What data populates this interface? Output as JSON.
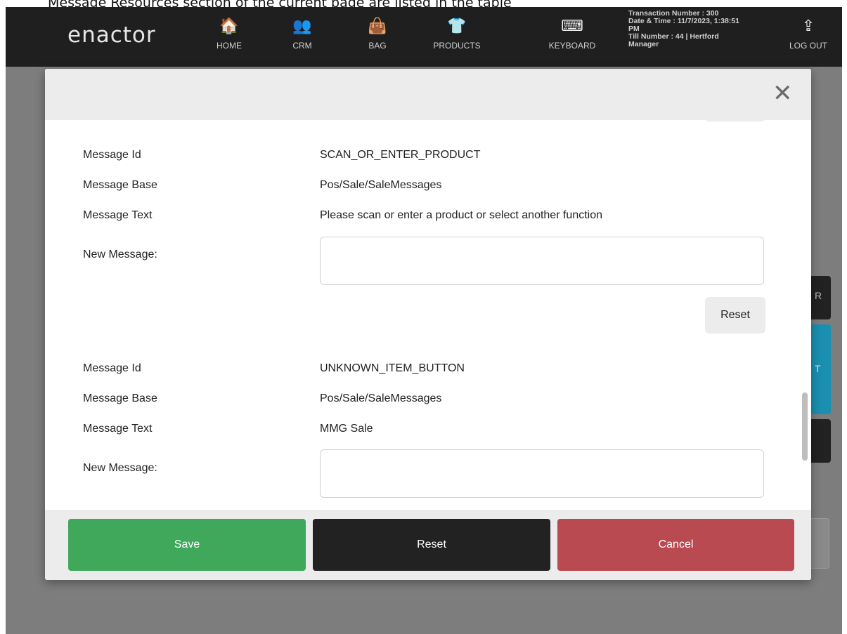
{
  "caption": "Message Resources section of the current page are listed in the table",
  "nav": {
    "logo": "enactor",
    "items": [
      {
        "label": "HOME",
        "icon": "home-icon",
        "glyph": "🏠"
      },
      {
        "label": "CRM",
        "icon": "people-icon",
        "glyph": "👥"
      },
      {
        "label": "BAG",
        "icon": "bag-icon",
        "glyph": "👜"
      },
      {
        "label": "PRODUCTS",
        "icon": "tshirt-icon",
        "glyph": "👕"
      },
      {
        "label": "KEYBOARD",
        "icon": "keyboard-icon",
        "glyph": "⌨"
      }
    ],
    "transaction_number": "Transaction Number : 300",
    "date_time": "Date & Time : 11/7/2023, 1:38:51 PM",
    "till": "Till Number : 44  |  Hertford Manager",
    "logout": {
      "label": "LOG OUT",
      "icon": "logout-icon",
      "glyph": "⇪"
    }
  },
  "modal": {
    "close_glyph": "✕",
    "messages": [
      {
        "id_label": "Message Id",
        "id_value": "SCAN_OR_ENTER_PRODUCT",
        "base_label": "Message Base",
        "base_value": "Pos/Sale/SaleMessages",
        "text_label": "Message Text",
        "text_value": "Please scan or enter a product or select another function",
        "new_label": "New Message:",
        "new_value": "",
        "reset_label": "Reset"
      },
      {
        "id_label": "Message Id",
        "id_value": "UNKNOWN_ITEM_BUTTON",
        "base_label": "Message Base",
        "base_value": "Pos/Sale/SaleMessages",
        "text_label": "Message Text",
        "text_value": "MMG Sale",
        "new_label": "New Message:",
        "new_value": ""
      }
    ],
    "footer": {
      "save_label": "Save",
      "reset_label": "Reset",
      "cancel_label": "Cancel"
    }
  },
  "background_buttons": [
    "R",
    "T"
  ],
  "colors": {
    "navbar": "#1f1f1f",
    "save": "#3fa85b",
    "reset": "#222222",
    "cancel": "#b94a51",
    "side_teal": "#1a8fb0"
  }
}
